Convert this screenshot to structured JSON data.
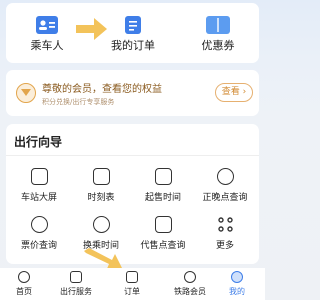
{
  "quick_actions": [
    {
      "label": "乘车人",
      "icon": "passenger-card-icon"
    },
    {
      "label": "我的订单",
      "icon": "order-list-icon"
    },
    {
      "label": "优惠券",
      "icon": "coupon-icon"
    }
  ],
  "member": {
    "title": "尊敬的会员，查看您的权益",
    "subtitle": "积分兑换/出行专享服务",
    "view_label": "查看",
    "icon": "crown-icon"
  },
  "guide": {
    "title": "出行向导",
    "items": [
      {
        "label": "车站大屏",
        "icon": "station-screen-icon"
      },
      {
        "label": "时刻表",
        "icon": "timetable-icon"
      },
      {
        "label": "起售时间",
        "icon": "sale-calendar-icon"
      },
      {
        "label": "正晚点查询",
        "icon": "clock-icon"
      },
      {
        "label": "票价查询",
        "icon": "fare-icon"
      },
      {
        "label": "换乘时间",
        "icon": "transfer-icon"
      },
      {
        "label": "代售点查询",
        "icon": "agency-icon"
      },
      {
        "label": "更多",
        "icon": "more-icon"
      }
    ]
  },
  "tabbar": [
    {
      "label": "首页",
      "icon": "home-train-icon"
    },
    {
      "label": "出行服务",
      "icon": "luggage-icon"
    },
    {
      "label": "订单",
      "icon": "order-icon"
    },
    {
      "label": "铁路会员",
      "icon": "diamond-icon"
    },
    {
      "label": "我的",
      "icon": "profile-icon"
    }
  ],
  "colors": {
    "accent": "#3f7ee8",
    "annotation_arrow": "#f3c35a",
    "gold": "#d18a32"
  }
}
